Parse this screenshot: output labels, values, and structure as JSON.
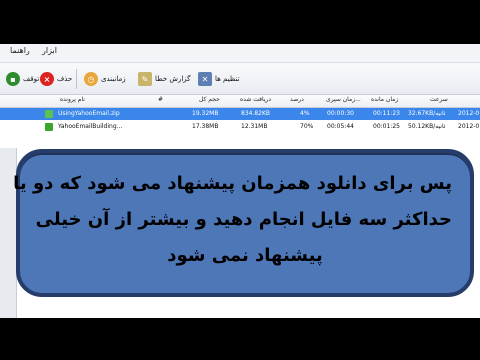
{
  "menu": {
    "items": [
      "راهنما",
      "ابزار"
    ]
  },
  "toolbar": {
    "stop_label": "توقف",
    "delete_label": "حذف",
    "schedule_label": "زمانبندی",
    "report_label": "گزارش خطا",
    "settings_label": "تنظیم ها"
  },
  "table": {
    "headers": {
      "name": "نام پرونده",
      "number": "#",
      "size": "حجم کل",
      "received": "دریافت شده",
      "percent": "درصد",
      "elapsed": "زمان سپری...",
      "remaining": "زمان مانده",
      "speed": "سرعت"
    },
    "rows": [
      {
        "name": "UsingYahooEmail.zip",
        "size": "19.32MB",
        "received": "834.82KB",
        "percent": "4%",
        "elapsed": "00:00:30",
        "remaining": "00:11:23",
        "speed": "32.67KB/ثانیه",
        "date": "2012-0",
        "selected": true
      },
      {
        "name": "YahooEmailBuilding...",
        "size": "17.38MB",
        "received": "12.31MB",
        "percent": "70%",
        "elapsed": "00:05:44",
        "remaining": "00:01:25",
        "speed": "50.12KB/ثانیه",
        "date": "2012-0",
        "selected": false
      }
    ]
  },
  "overlay": {
    "lines": [
      "پس برای دانلود همزمان پیشنهاد می شود که دو یا",
      "حداکثر سه فایل انجام دهید و  بیشتر از آن خیلی",
      "پیشنهاد نمی شود"
    ]
  }
}
